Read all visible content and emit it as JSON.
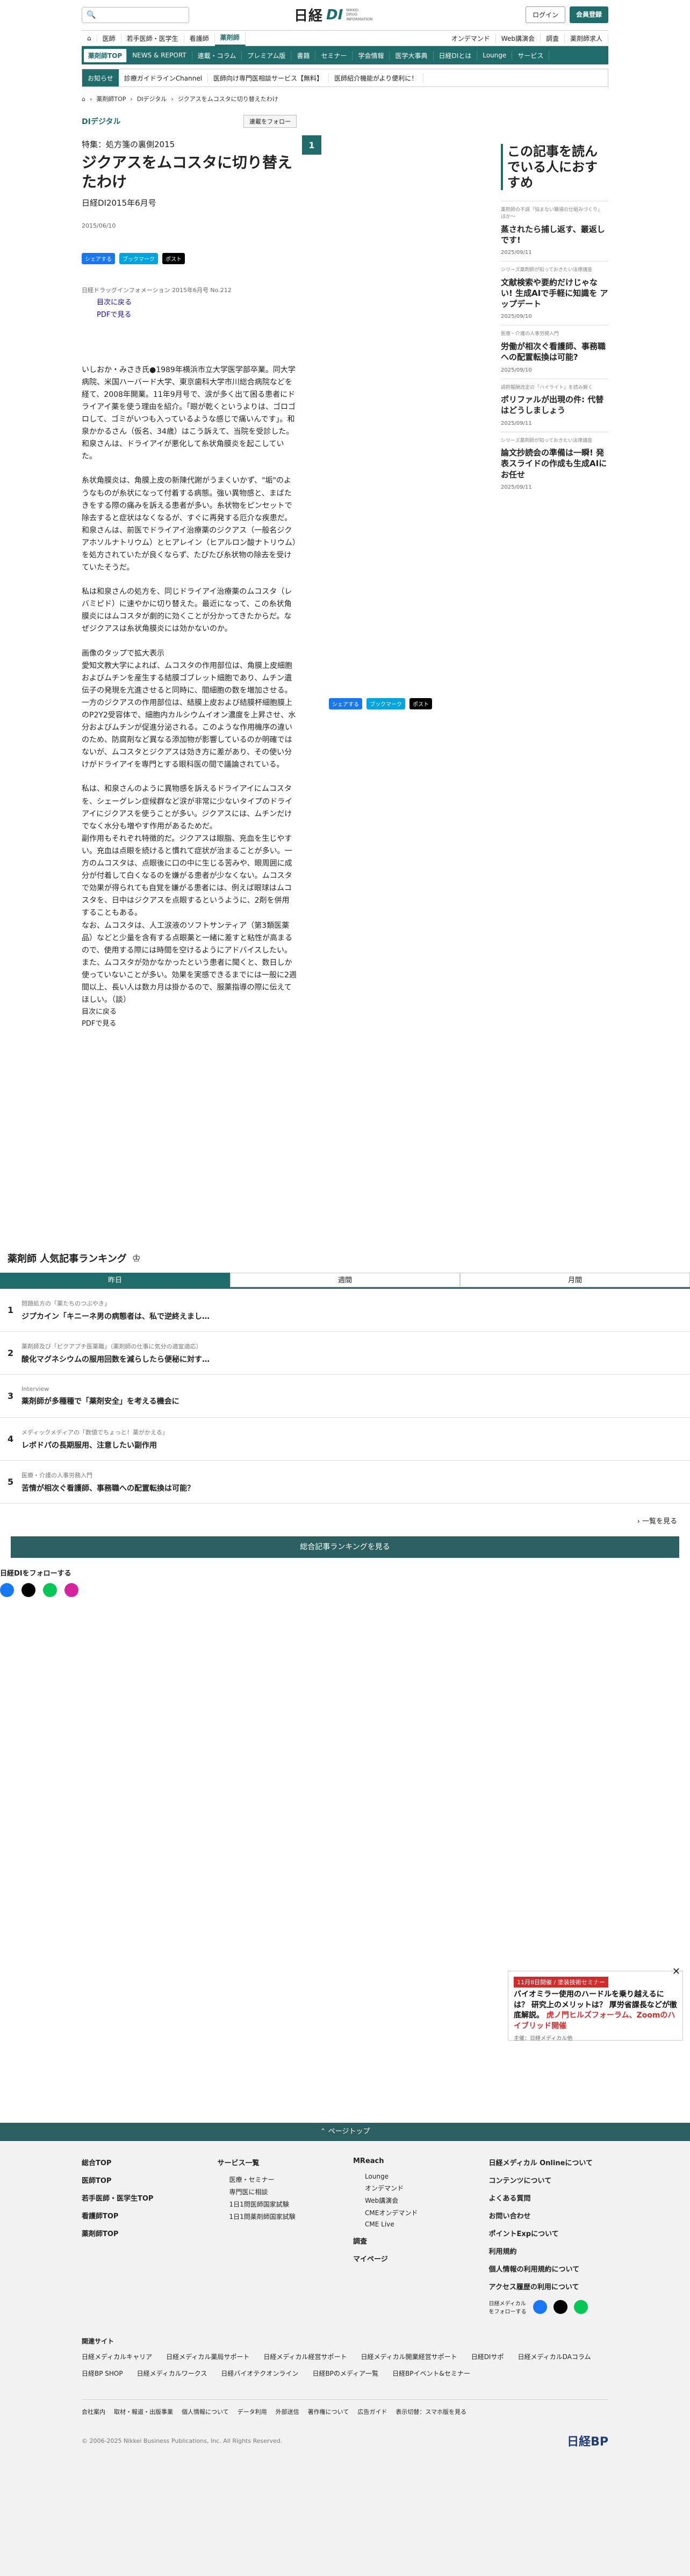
{
  "header": {
    "search_placeholder": "",
    "logo_main": "日経",
    "logo_di": "DI",
    "logo_sub1": "NIKKEI",
    "logo_sub2": "DRUG",
    "logo_sub3": "INFORMATION",
    "login": "ログイン",
    "register": "会員登録"
  },
  "nav1": {
    "items": [
      "医師",
      "若手医師・医学生",
      "看護師",
      "薬剤師"
    ],
    "right": [
      "オンデマンド",
      "Web講演会",
      "調査",
      "薬剤師求人"
    ]
  },
  "nav2": {
    "items": [
      "薬剤師TOP",
      "NEWS & REPORT",
      "連載・コラム",
      "プレミアム版",
      "書籍",
      "セミナー",
      "学会情報",
      "医学大事典",
      "日経DIとは",
      "Lounge",
      "サービス"
    ]
  },
  "notice": {
    "label": "お知らせ",
    "items": [
      "診療ガイドラインChannel",
      "医師向け専門医相談サービス【無料】",
      "医師紹介機能がより便利に！"
    ]
  },
  "breadcrumb": [
    "薬剤師TOP",
    "DIデジタル",
    "ジクアスをムコスタに切り替えたわけ"
  ],
  "article": {
    "category": "DIデジタル",
    "follow": "連載をフォロー",
    "series": "特集：処方箋の裏側2015",
    "title": "ジクアスをムコスタに切り替えたわけ",
    "source": "日経DI2015年6月号",
    "date": "2015/06/10",
    "share_fb": "シェアする",
    "share_hb": "ブックマーク",
    "share_x": "ポスト",
    "image_caption": "日経ドラッグインフォメーション 2015年6月号 No.212",
    "link_toc": "目次に戻る",
    "link_pdf": "PDFで見る",
    "paragraphs": [
      "いしおか・みさき氏●1989年横浜市立大学医学部卒業。同大学病院、米国ハーバード大学、東京歯科大学市川総合病院などを経て、2008年開業。11年9月号で、涙が多く出て困る患者にドライアイ薬を使う理由を紹介。「眼が乾くというよりは、ゴロゴロして、ゴミがいつも入っているような感じで痛いんです」。和泉かかるさん（仮名、34歳）はこう訴えて、当院を受診した。和泉さんは、ドライアイが悪化して糸状角膜炎を起こしていた。",
      "糸状角膜炎は、角膜上皮の新陳代謝がうまくいかず、\"垢\"のようなものが糸状になって付着する病態。強い異物感と、まばたきをする際の痛みを訴える患者が多い。糸状物をピンセットで除去すると症状はなくなるが、すぐに再発する厄介な疾患だ。和泉さんは、前医でドライアイ治療薬のジクアス（一般名ジクアホソルナトリウム）とヒアレイン（ヒアルロン酸ナトリウム）を処方されていたが良くならず、たびたび糸状物の除去を受けていたそうだ。",
      "私は和泉さんの処方を、同じドライアイ治療薬のムコスタ（レバミピド）に速やかに切り替えた。最近になって、この糸状角膜炎にはムコスタが劇的に効くことが分かってきたからだ。なぜジクアスは糸状角膜炎には効かないのか。"
    ],
    "paragraphs2": [
      "画像のタップで拡大表示",
      "愛知文教大学によれば、ムコスタの作用部位は、角膜上皮細胞およびムチンを産生する結膜ゴブレット細胞であり、ムチン遺伝子の発現を亢進させると同時に、間細胞の数を増加させる。一方のジクアスの作用部位は、結膜上皮および結膜杯細胞膜上のP2Y2受容体で、細胞内カルシウムイオン濃度を上昇させ、水分およびムチンが促進分泌される。このような作用機序の違いのため、防腐剤など異なる添加物が影響しているのか明確ではないが、ムコスタとジクアスは効き方に差があり、その使い分けがドライアイを専門とする眼科医の間で議論されている。",
      "私は、和泉さんのように異物感を訴えるドライアイにムコスタを、シェーグレン症候群など涙が非常に少ないタイプのドライアイにジクアスを使うことが多い。ジクアスには、ムチンだけでなく水分も増やす作用があるためだ。",
      "副作用もそれぞれ特徴的だ。ジクアスは眼脂、充血を生じやすい。充血は点眼を続けると慣れて症状が治まることが多い。一方のムコスタは、点眼後に口の中に生じる苦みや、眼周囲に成分が付着して白くなるのを嫌がる患者が少なくない。ムコスタで効果が得られても自覚を嫌がる患者には、例えば眼球はムコスタを、日中はジクアスを点眼するというように、2剤を併用することもある。",
      "なお、ムコスタは、人工涙液のソフトサンティア（第3類医薬品）などと少量を含有する点眼薬と一緒に差すと粘性が高まるので、使用する際には時間を空けるようにアドバイスしたい。また、ムコスタが効かなかったという患者に聞くと、数日しか使っていないことが多い。効果を実感できるまでには一般に2週間以上、長い人は数カ月は掛かるので、服薬指導の際に伝えてほしい。（談）"
    ]
  },
  "side": {
    "heading": "この記事を読んでいる人におすすめ",
    "items": [
      {
        "cat": "薬剤師の不調「悩まない職場の仕組みづくり」 ほか～",
        "title": "蒸されたら捕し返す、叢返しです!",
        "date": "2025/09/11"
      },
      {
        "cat": "シリーズ薬剤師が知っておきたい法律講座",
        "title": "文献検索や要約だけじゃない! 生成AIで手軽に知識を アップデート",
        "date": "2025/09/10"
      },
      {
        "cat": "医療・介護の人事労務入門",
        "title": "労働が相次ぐ看護師、事務職への配置転換は可能?",
        "date": "2025/09/10"
      },
      {
        "cat": "調剤報酬改定の「ハイライト」を読み解く",
        "title": "ポリファルが出現の件: 代替はどうしましょう",
        "date": "2025/09/11"
      },
      {
        "cat": "シリーズ薬剤師が知っておきたい法律講座",
        "title": "論文抄読会の準備は一瞬! 発表スライドの作成も生成AIにお任せ",
        "date": "2025/09/11"
      }
    ]
  },
  "ranking": {
    "title": "薬剤師 人気記事ランキング",
    "tabs": [
      "昨日",
      "週間",
      "月間"
    ],
    "items": [
      {
        "cat": "問題処方の「薬たちのつぶやき」",
        "title": "ジプカイン「キニーネ男の病態者は、私で逆終えまし…"
      },
      {
        "cat": "薬剤師及び「ピクアプチ医薬職」（薬剤師の仕事に気分の適宜適応）",
        "title": "酸化マグネシウムの服用回数を減らしたら便秘に対す…"
      },
      {
        "cat": "Interview",
        "title": "薬剤師が多種種で「薬剤安全」を考える機会に"
      },
      {
        "cat": "メディックメディアの「数値でちょっと！薬がかえる」",
        "title": "レボドパの長期服用、注意したい副作用"
      },
      {
        "cat": "医療・介護の人事労務入門",
        "title": "苦情が相次ぐ看護師、事務職への配置転換は可能？"
      }
    ],
    "more": "一覧を見る",
    "all_button": "総合記事ランキングを見る",
    "follow": "日経DIをフォローする"
  },
  "ad": {
    "tag": "11月8日開催 / 塗装技術セミナー",
    "title_a": "バイオミラー使用のハードルを乗り越えるには？ 研究上のメリットは？ 厚労省課長などが徹底解説。",
    "title_b": "虎ノ門ヒルズフォーラム、Zoomのハイブリッド開催",
    "sponsor": "主催：日経メディカル他",
    "close": "✕"
  },
  "footer": {
    "pagetop": "ページトップ",
    "col1": [
      "総合TOP",
      "医師TOP",
      "若手医師・医学生TOP",
      "看護師TOP",
      "薬剤師TOP"
    ],
    "col2_head": "サービス一覧",
    "col2": [
      "医療・セミナー",
      "専門医に相談",
      "1日1問医師国家試験",
      "1日1問薬剤師国家試験"
    ],
    "col3_head": "MReach",
    "col3": [
      "Lounge",
      "オンデマンド",
      "Web講演会",
      "CMEオンデマンド",
      "CME Live"
    ],
    "col3b": [
      "調査",
      "マイページ"
    ],
    "col4": [
      "日経メディカル Onlineについて",
      "コンテンツについて",
      "よくある質問",
      "お問い合わせ",
      "ポイントExpについて",
      "利用規約",
      "個人情報の利用規約について",
      "アクセス履歴の利用について"
    ],
    "follow": "日経メディカルをフォローする",
    "related_head": "関連サイト",
    "related": [
      "日経メディカルキャリア",
      "日経メディカル薬局サポート",
      "日経メディカル経営サポート",
      "日経メディカル開業経営サポート",
      "日経DIサポ",
      "日経メディカルDAコラム",
      "日経BP SHOP",
      "日経メディカルワークス",
      "日経バイオテクオンライン",
      "日経BPのメディア一覧",
      "日経BPイベント&セミナー"
    ],
    "bottom": [
      "会社案内",
      "取材・報道・出版事業",
      "個人情報について",
      "データ利用",
      "外部送信",
      "著作権について",
      "広告ガイド",
      "表示切替：スマホ版を見る"
    ],
    "copyright": "© 2006-2025 Nikkei Business Publications, Inc. All Rights Reserved.",
    "nbp": "日経BP"
  }
}
